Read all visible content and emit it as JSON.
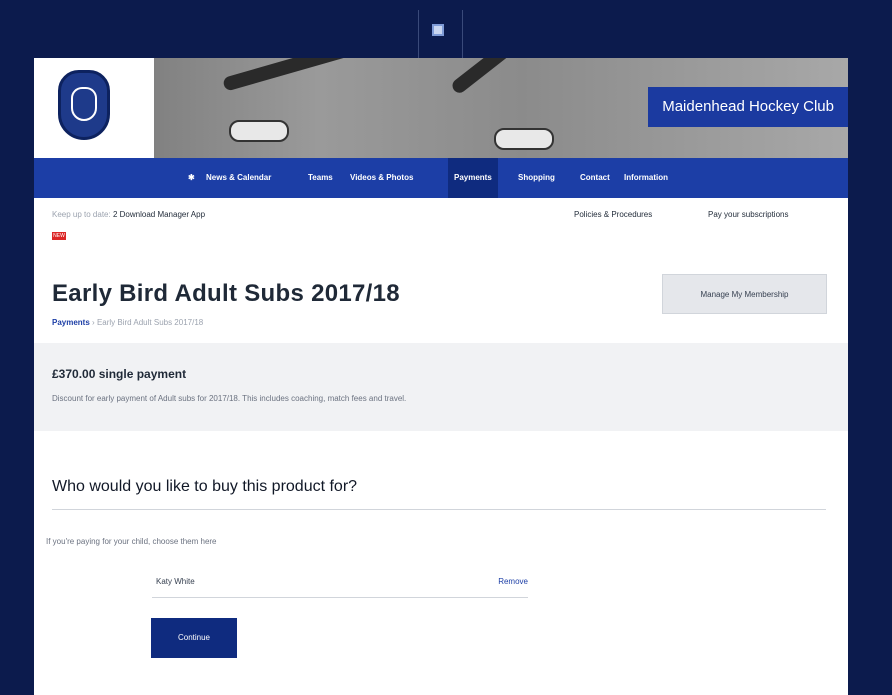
{
  "hero": {
    "club_name": "Maidenhead Hockey Club"
  },
  "nav": {
    "items": [
      "News & Calendar",
      "Teams",
      "Videos & Photos",
      "Payments",
      "Shopping",
      "Contact",
      "Information"
    ],
    "active_index": 3
  },
  "utility": {
    "keep_up_label": "Keep up to date:",
    "app_number": "2",
    "download_app": "Download Manager App",
    "new_badge": "NEW",
    "policies": "Policies & Procedures",
    "pay_subscriptions": "Pay your subscriptions"
  },
  "product": {
    "title": "Early Bird Adult Subs 2017/18",
    "breadcrumb_link": "Payments",
    "breadcrumb_sep": "›",
    "breadcrumb_current": "Early Bird Adult Subs 2017/18",
    "manage_button": "Manage My Membership",
    "price": "£370.00 single payment",
    "description": "Discount for early payment of Adult subs for 2017/18. This includes coaching, match fees and travel."
  },
  "purchase": {
    "heading": "Who would you like to buy this product for?",
    "hint": "If you're paying for your child, choose them here",
    "member_name": "Katy White",
    "remove_label": "Remove",
    "continue_label": "Continue"
  }
}
